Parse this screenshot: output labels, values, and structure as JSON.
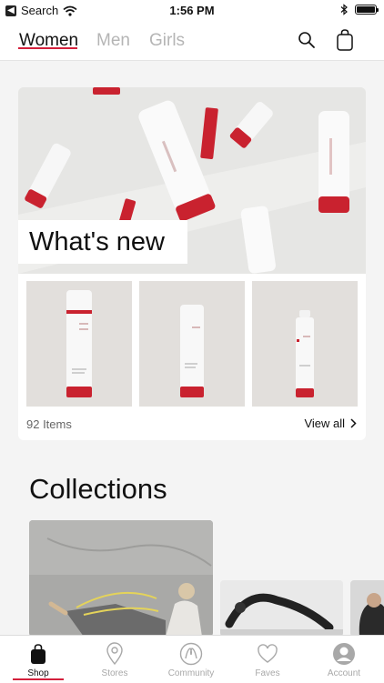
{
  "status_bar": {
    "back_label": "Search",
    "time": "1:56 PM"
  },
  "nav": {
    "tabs": [
      {
        "label": "Women"
      },
      {
        "label": "Men"
      },
      {
        "label": "Girls"
      }
    ]
  },
  "whats_new": {
    "title": "What's new",
    "item_count": "92 Items",
    "view_all": "View all"
  },
  "collections": {
    "title": "Collections"
  },
  "tabbar": {
    "items": [
      {
        "label": "Shop",
        "icon": "shopping-bag-icon"
      },
      {
        "label": "Stores",
        "icon": "location-pin-icon"
      },
      {
        "label": "Community",
        "icon": "lululemon-logo-icon"
      },
      {
        "label": "Faves",
        "icon": "heart-icon"
      },
      {
        "label": "Account",
        "icon": "user-icon"
      }
    ]
  },
  "colors": {
    "accent": "#d31f3b",
    "text": "#111111",
    "muted": "#b5b5b5"
  }
}
